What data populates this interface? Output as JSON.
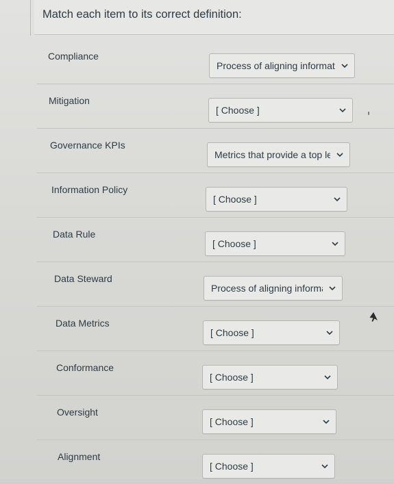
{
  "prompt": "Match each item to its correct definition:",
  "items": [
    {
      "term": "Compliance",
      "selected": "Process of aligning informati"
    },
    {
      "term": "Mitigation",
      "selected": "[ Choose ]"
    },
    {
      "term": "Governance KPIs",
      "selected": "Metrics that provide a top le"
    },
    {
      "term": "Information Policy",
      "selected": "[ Choose ]"
    },
    {
      "term": "Data Rule",
      "selected": "[ Choose ]"
    },
    {
      "term": "Data Steward",
      "selected": "Process of aligning informati"
    },
    {
      "term": "Data Metrics",
      "selected": "[ Choose ]"
    },
    {
      "term": "Conformance",
      "selected": "[ Choose ]"
    },
    {
      "term": "Oversight",
      "selected": "[ Choose ]"
    },
    {
      "term": "Alignment",
      "selected": "[ Choose ]"
    }
  ],
  "icons": {
    "dropdown": "chevron-down-icon",
    "pointer": "mouse-cursor-icon"
  },
  "colors": {
    "background": "#d9d9d6",
    "text": "#2d3b45",
    "select_border": "#b5b5b2",
    "chevron": "#2d3b45"
  }
}
